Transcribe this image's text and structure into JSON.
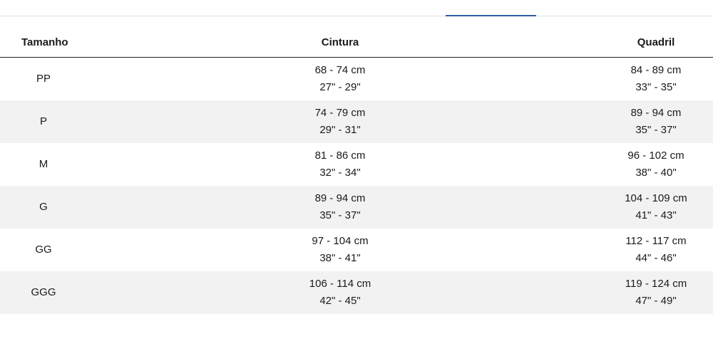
{
  "table": {
    "headers": {
      "size": "Tamanho",
      "waist": "Cintura",
      "hip": "Quadril"
    },
    "rows": [
      {
        "size": "PP",
        "waist_cm": "68 - 74 cm",
        "waist_in": "27\" - 29\"",
        "hip_cm": "84 - 89 cm",
        "hip_in": "33\" - 35\""
      },
      {
        "size": "P",
        "waist_cm": "74 - 79 cm",
        "waist_in": "29\" - 31\"",
        "hip_cm": "89 - 94 cm",
        "hip_in": "35\" - 37\""
      },
      {
        "size": "M",
        "waist_cm": "81 - 86 cm",
        "waist_in": "32\" - 34\"",
        "hip_cm": "96 - 102 cm",
        "hip_in": "38\" - 40\""
      },
      {
        "size": "G",
        "waist_cm": "89 - 94 cm",
        "waist_in": "35\" - 37\"",
        "hip_cm": "104 - 109 cm",
        "hip_in": "41\" - 43\""
      },
      {
        "size": "GG",
        "waist_cm": "97 - 104 cm",
        "waist_in": "38\" - 41\"",
        "hip_cm": "112 - 117 cm",
        "hip_in": "44\" - 46\""
      },
      {
        "size": "GGG",
        "waist_cm": "106 - 114 cm",
        "waist_in": "42\" - 45\"",
        "hip_cm": "119 - 124 cm",
        "hip_in": "47\" - 49\""
      }
    ]
  },
  "colors": {
    "tab_indicator": "#2d5f9e",
    "row_shade": "#f2f2f2",
    "header_rule": "#222222"
  }
}
